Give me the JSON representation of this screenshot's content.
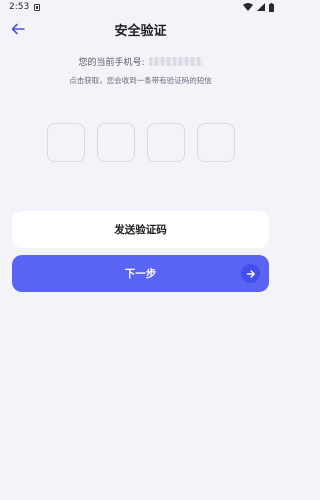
{
  "status_bar": {
    "time": "2:53",
    "icons": [
      "notification-icon",
      "wifi-icon",
      "signal-icon",
      "battery-icon"
    ]
  },
  "header": {
    "title": "安全验证",
    "back_icon": "back-arrow-icon"
  },
  "phone": {
    "label": "您的当前手机号:"
  },
  "hint": "点击获取，您会收到一条带有验证码的短信",
  "code_input": {
    "box_count": 4
  },
  "buttons": {
    "send_code_label": "发送验证码",
    "next_label": "下一步",
    "next_icon": "arrow-right-icon"
  },
  "colors": {
    "background": "#f3f3f9",
    "primary": "#5964f5",
    "back_icon": "#4a5bd8"
  }
}
